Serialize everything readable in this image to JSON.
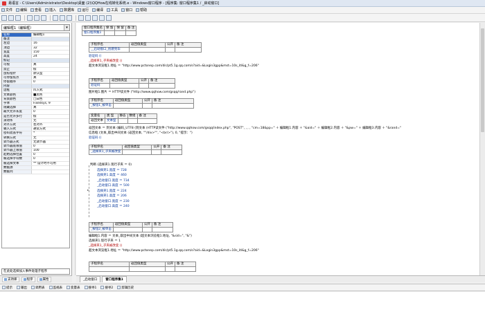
{
  "window": {
    "title": "易语言 - C:\\Users\\Administrator\\Desktop\\桌面 (2)\\QQHow在线转化系统.e - Windows窗口程序 - [程序集: 窗口程序集1 / _启动窗口]"
  },
  "menu": [
    "文件",
    "编辑",
    "查看",
    "插入",
    "数据库",
    "运行",
    "编译",
    "工具",
    "窗口",
    "帮助"
  ],
  "toolbar": {
    "items": [
      "new",
      "open",
      "save",
      "cut",
      "copy",
      "paste",
      "undo",
      "redo",
      "find",
      "run",
      "stop",
      "step",
      "debug",
      "breakpoint"
    ]
  },
  "left": {
    "object_selector": "编辑框1（编辑框）",
    "props": [
      [
        "名称",
        "编辑框1",
        "sel"
      ],
      [
        "备注",
        "",
        "cat"
      ],
      [
        "左边",
        "16",
        ""
      ],
      [
        "顶边",
        "32",
        ""
      ],
      [
        "宽度",
        "150",
        ""
      ],
      [
        "高度",
        "24",
        ""
      ],
      [
        "标记",
        "",
        "cat"
      ],
      [
        "可视",
        "真",
        ""
      ],
      [
        "禁止",
        "假",
        ""
      ],
      [
        "鼠标指针",
        "默认型",
        ""
      ],
      [
        "可停留焦点",
        "真",
        ""
      ],
      [
        "停留顺序",
        "0",
        ""
      ],
      [
        "内容",
        "",
        "cat"
      ],
      [
        "边框",
        "凹入式",
        ""
      ],
      [
        "文本颜色",
        "■黑色",
        ""
      ],
      [
        "背景颜色",
        "□白色",
        ""
      ],
      [
        "字体",
        "Fixedsys, 9",
        ""
      ],
      [
        "隐藏选择",
        "真",
        ""
      ],
      [
        "最大允许长度",
        "0",
        ""
      ],
      [
        "是否允许多行",
        "假",
        ""
      ],
      [
        "滚动条",
        "无",
        ""
      ],
      [
        "对齐方式",
        "左对齐",
        ""
      ],
      [
        "输入方式",
        "通常方式",
        ""
      ],
      [
        "密码遮盖字符",
        "*",
        ""
      ],
      [
        "转换方式",
        "无",
        ""
      ],
      [
        "调节器方式",
        "无调节器",
        ""
      ],
      [
        "调节器底限值",
        "0",
        ""
      ],
      [
        "调节器上限值",
        "100",
        ""
      ],
      [
        "起始选择位置",
        "0",
        ""
      ],
      [
        "被选择字符数",
        "0",
        ""
      ],
      [
        "被选择文本",
        "** 设计时不可用",
        ""
      ],
      [
        "数据源",
        "",
        ""
      ],
      [
        "数据列",
        "",
        ""
      ]
    ],
    "event_selector": "在此处选择加入事件处理子程序",
    "tabs": [
      "支持库",
      "程序",
      "属性"
    ]
  },
  "editor": {
    "t1": {
      "h": [
        "窗口程序集名",
        "保 留",
        "保 留",
        "备 注"
      ],
      "r": [
        "窗口程序集1",
        "",
        "",
        ""
      ]
    },
    "t2": {
      "h": [
        "子程序名",
        "返回值类型",
        "公开",
        "备 注"
      ],
      "r": [
        "__启动窗口_创建完毕",
        "",
        "",
        ""
      ]
    },
    "l_a": "验证码 ()",
    "l_b": "_选择夹1_子夹被改变 ()",
    "l_c": "超文本浏览框1.地址 ＝ \"http://www.pctonep.com/dir/pt5.1g.qq.com/s?aid=&Login3gpp&mst=10s_itl&g_f=206\"",
    "t3": {
      "h": [
        "子程序名",
        "返回值类型",
        "公开",
        "备 注"
      ],
      "r": [
        "验证码",
        "",
        "",
        ""
      ]
    },
    "l_d": "图片框1.图片 ＝ HTTP读文件 (\"http://www.qqhow.com/gsqq/rand.php\")",
    "t4": {
      "h": [
        "子程序名",
        "返回值类型",
        "公开",
        "备 注"
      ],
      "r": [
        "_按钮1_被单击",
        "",
        "",
        ""
      ]
    },
    "t5": {
      "h": [
        "变量名",
        "类 型",
        "静态",
        "数组",
        "备 注"
      ],
      "r": [
        "返回文本",
        "文本型",
        "",
        "",
        ""
      ]
    },
    "l_e": "返回文本 ＝ 到文本 (编码_UTF8 (到文本 (HTTP读文件 (\"http://www.qqhow.com/gsqq/index.php\", \"POST\", , , , \"cm=18&pp=\" ＋ 编辑框1.内容 ＋ \"&aid=\" ＋ 编辑框2.内容 ＋ \"&pw=\" ＋ 编辑框3.内容 ＋ \"&rand=\"",
    "l_f": "信息框 (文本_取出中间文本 (返回文本, \"\"/div>\"\", \"<br/>\"), 0, \"提示：\")",
    "l_g": "验证码 ()",
    "t6": {
      "h": [
        "子程序名",
        "返回值类型",
        "公开",
        "备 注"
      ],
      "r": [
        "_选择夹1_子夹被改变",
        "",
        "",
        ""
      ]
    },
    "flow": [
      "判断 (选择夹1.现行子夹 ＝ 0)",
      "选择夹1.宽度 ＝ 728",
      "选择夹1.高度 ＝ 460",
      "_启动窗口.宽度 ＝ 734",
      "_启动窗口.高度 ＝ 500",
      "选择夹1.宽度 ＝ 224",
      "选择夹1.高度 ＝ 206",
      "_启动窗口.宽度 ＝ 230",
      "_启动窗口.高度 ＝ 240",
      ""
    ],
    "t7": {
      "h": [
        "子程序名",
        "返回值类型",
        "公开",
        "备 注"
      ],
      "r": [
        "_按钮2_被单击",
        "",
        "",
        ""
      ]
    },
    "l_h": "编辑框1.内容 ＝ 文本_取出中间文本 (超文本浏览框1.地址, \"&sid=\", \"&\")",
    "l_i": "选择夹1.现行子夹 ＝ 1",
    "l_j": "_选择夹1_子夹被改变 ()",
    "l_k": "超文本浏览框1.地址 ＝ \"http://www.pctonep.com/dir/pt5.1g.qq.com/s?aid=&Login3gpp&mst=10s_itl&g_f=206\"",
    "t8": {
      "h": [
        "子程序名",
        "返回值类型",
        "公开",
        "备 注"
      ]
    }
  },
  "doctabs": [
    "_启动窗口",
    "窗口程序集1"
  ],
  "bottom_tabs": [
    "提示",
    "输出",
    "调用表",
    "监视表",
    "变量表",
    "搜寻1",
    "搜寻2",
    "剪辑历史"
  ]
}
